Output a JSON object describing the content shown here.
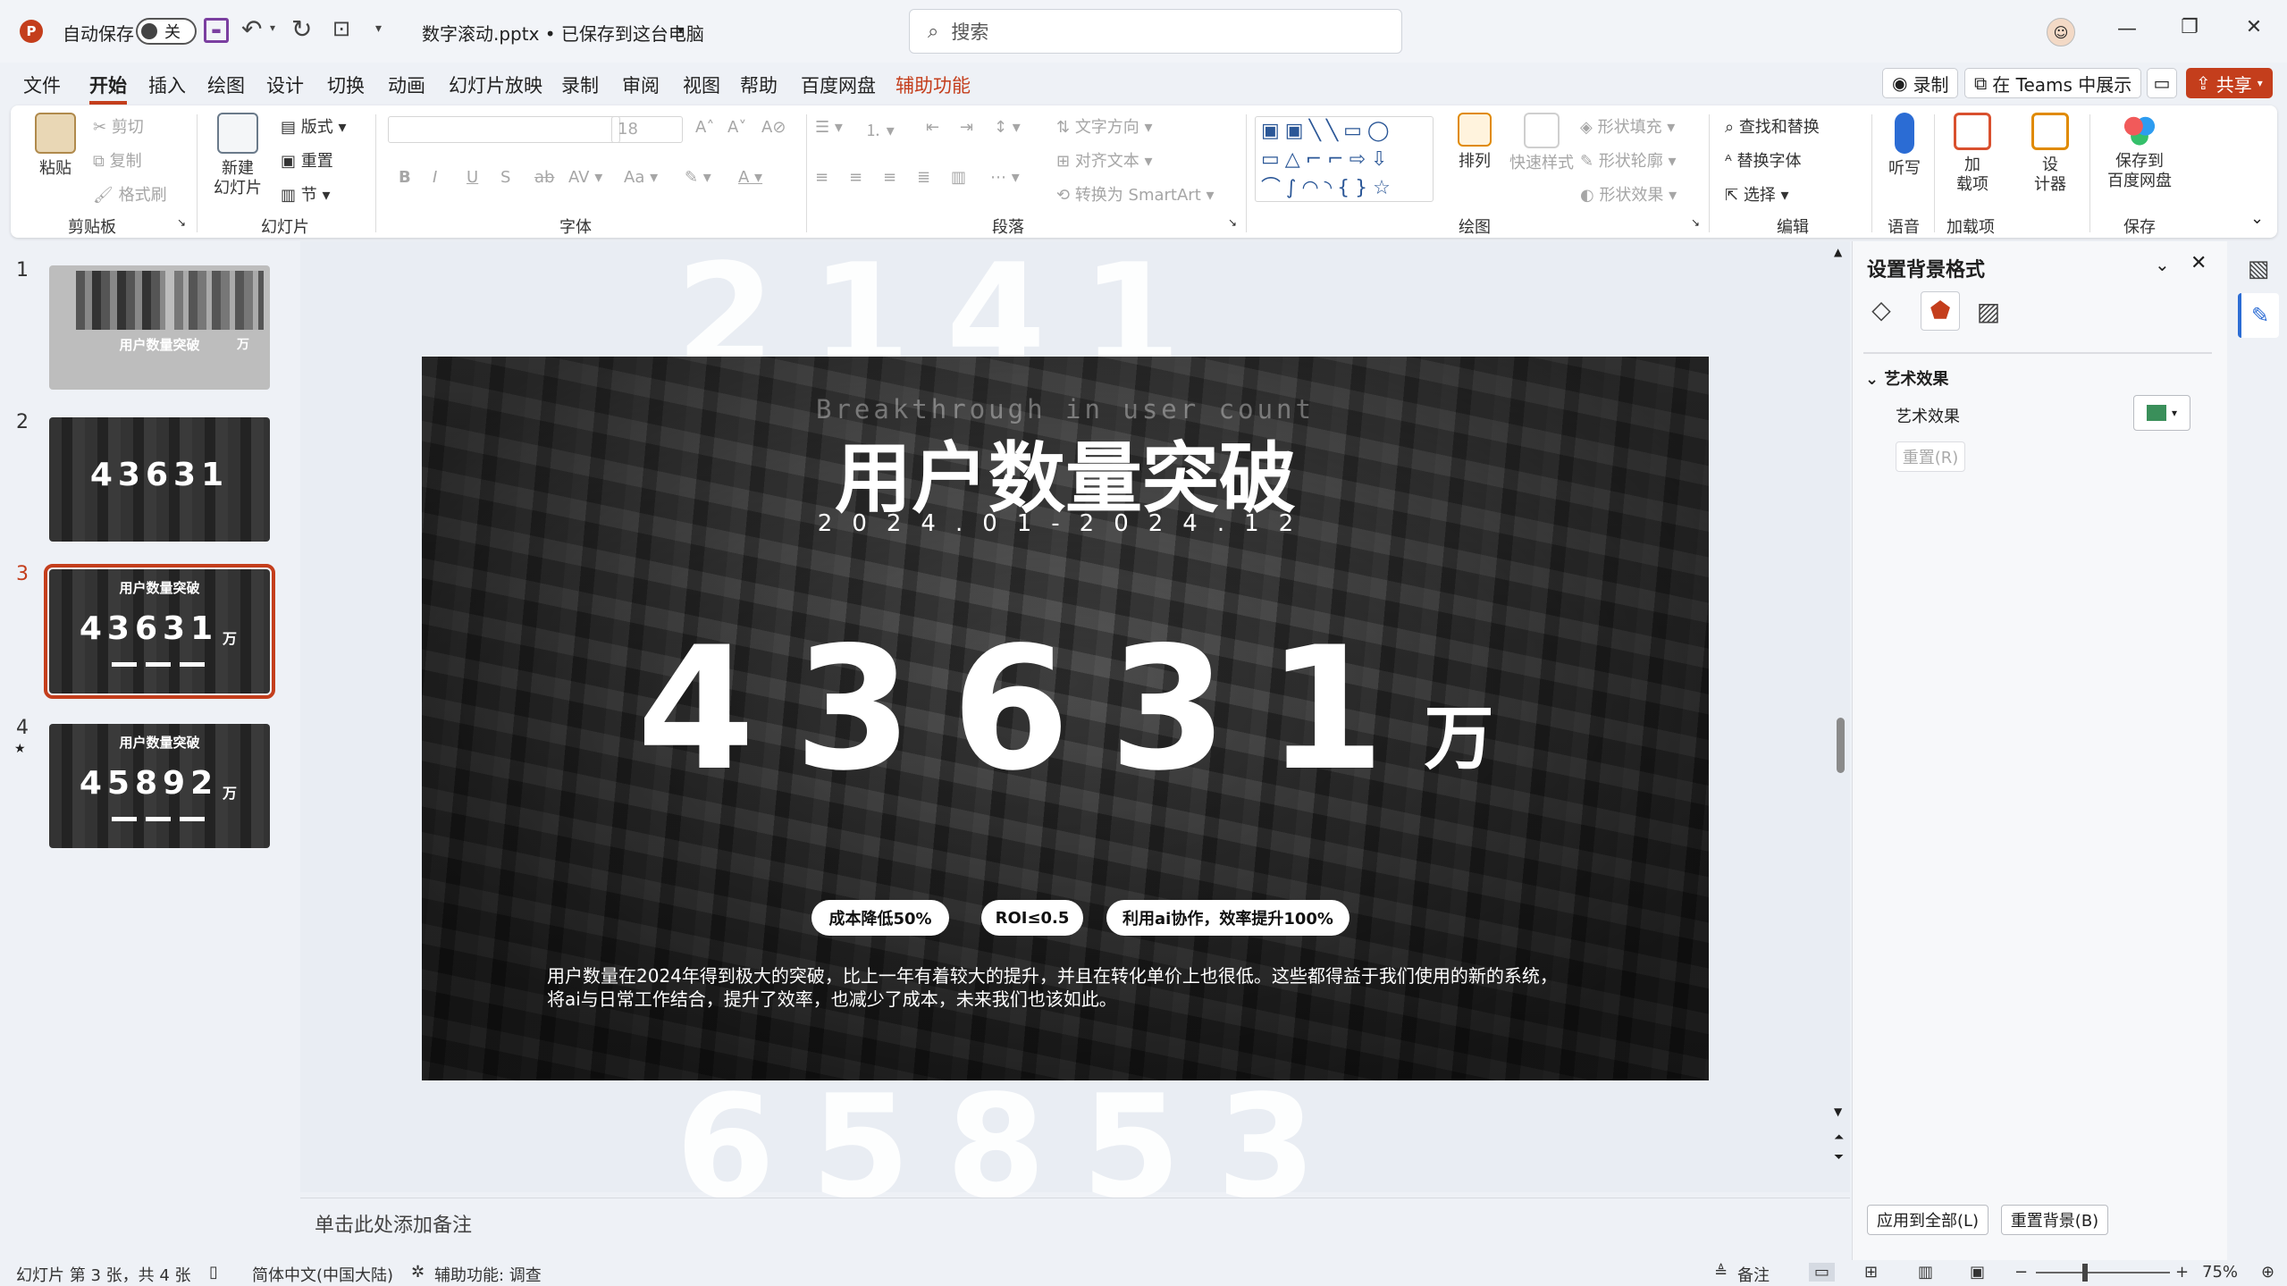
{
  "titlebar": {
    "autosave_label": "自动保存",
    "autosave_state": "关",
    "doc_title": "数字滚动.pptx • 已保存到这台电脑",
    "search_placeholder": "搜索"
  },
  "menu": {
    "tabs": [
      "文件",
      "开始",
      "插入",
      "绘图",
      "设计",
      "切换",
      "动画",
      "幻灯片放映",
      "录制",
      "审阅",
      "视图",
      "帮助",
      "百度网盘",
      "辅助功能"
    ],
    "active": "开始",
    "record": "录制",
    "teams": "在 Teams 中展示",
    "share": "共享"
  },
  "ribbon": {
    "clipboard": {
      "label": "剪贴板",
      "paste": "粘贴",
      "cut": "剪切",
      "copy": "复制",
      "format_painter": "格式刷"
    },
    "slides": {
      "label": "幻灯片",
      "new_slide_1": "新建",
      "new_slide_2": "幻灯片",
      "layout": "版式",
      "reset": "重置",
      "section": "节"
    },
    "font": {
      "label": "字体",
      "size": "18"
    },
    "paragraph": {
      "label": "段落",
      "text_direction": "文字方向",
      "align_text": "对齐文本",
      "smartart": "转换为 SmartArt"
    },
    "drawing": {
      "label": "绘图",
      "arrange": "排列",
      "quick_styles": "快速样式",
      "shape_fill": "形状填充",
      "shape_outline": "形状轮廓",
      "shape_effects": "形状效果"
    },
    "editing": {
      "label": "编辑",
      "find_replace": "查找和替换",
      "replace_font": "替换字体",
      "select": "选择"
    },
    "voice": {
      "label": "语音",
      "dictate": "听写"
    },
    "addins": {
      "label": "加载项",
      "addins_1": "加",
      "addins_2": "载项"
    },
    "designer": {
      "d1": "设",
      "d2": "计器"
    },
    "save": {
      "label": "保存",
      "s1": "保存到",
      "s2": "百度网盘"
    }
  },
  "thumbnails": [
    {
      "num": "1",
      "title": "用户数量突破",
      "unit": "万"
    },
    {
      "num": "2",
      "digits": "43631"
    },
    {
      "num": "3",
      "title": "用户数量突破",
      "digits": "43631",
      "unit": "万"
    },
    {
      "num": "4",
      "title": "用户数量突破",
      "digits": "45892",
      "unit": "万"
    }
  ],
  "slide": {
    "ghost_top": "2141",
    "ghost_bottom": "65853",
    "subtitle_en": "Breakthrough in user count",
    "title": "用户数量突破",
    "date": "2024.01-2024.12",
    "digits": "43631",
    "unit": "万",
    "pills": [
      "成本降低50%",
      "ROI≤0.5",
      "利用ai协作，效率提升100%"
    ],
    "body_1": "用户数量在2024年得到极大的突破，比上一年有着较大的提升，并且在转化单价上也很低。这些都得益于我们使用的新的系统，",
    "body_2": "将ai与日常工作结合，提升了效率，也减少了成本，未来我们也该如此。"
  },
  "notes_placeholder": "单击此处添加备注",
  "pane": {
    "title": "设置背景格式",
    "section": "艺术效果",
    "row_label": "艺术效果",
    "reset": "重置(R)",
    "apply_all": "应用到全部(L)",
    "reset_bg": "重置背景(B)"
  },
  "status": {
    "slide_info": "幻灯片 第 3 张，共 4 张",
    "language": "简体中文(中国大陆)",
    "accessibility": "辅助功能: 调查",
    "notes": "备注",
    "zoom": "75%"
  },
  "colors": {
    "accent": "#c43e1c",
    "ribbon_bg": "#ffffff",
    "window_bg": "#eef1f6"
  }
}
